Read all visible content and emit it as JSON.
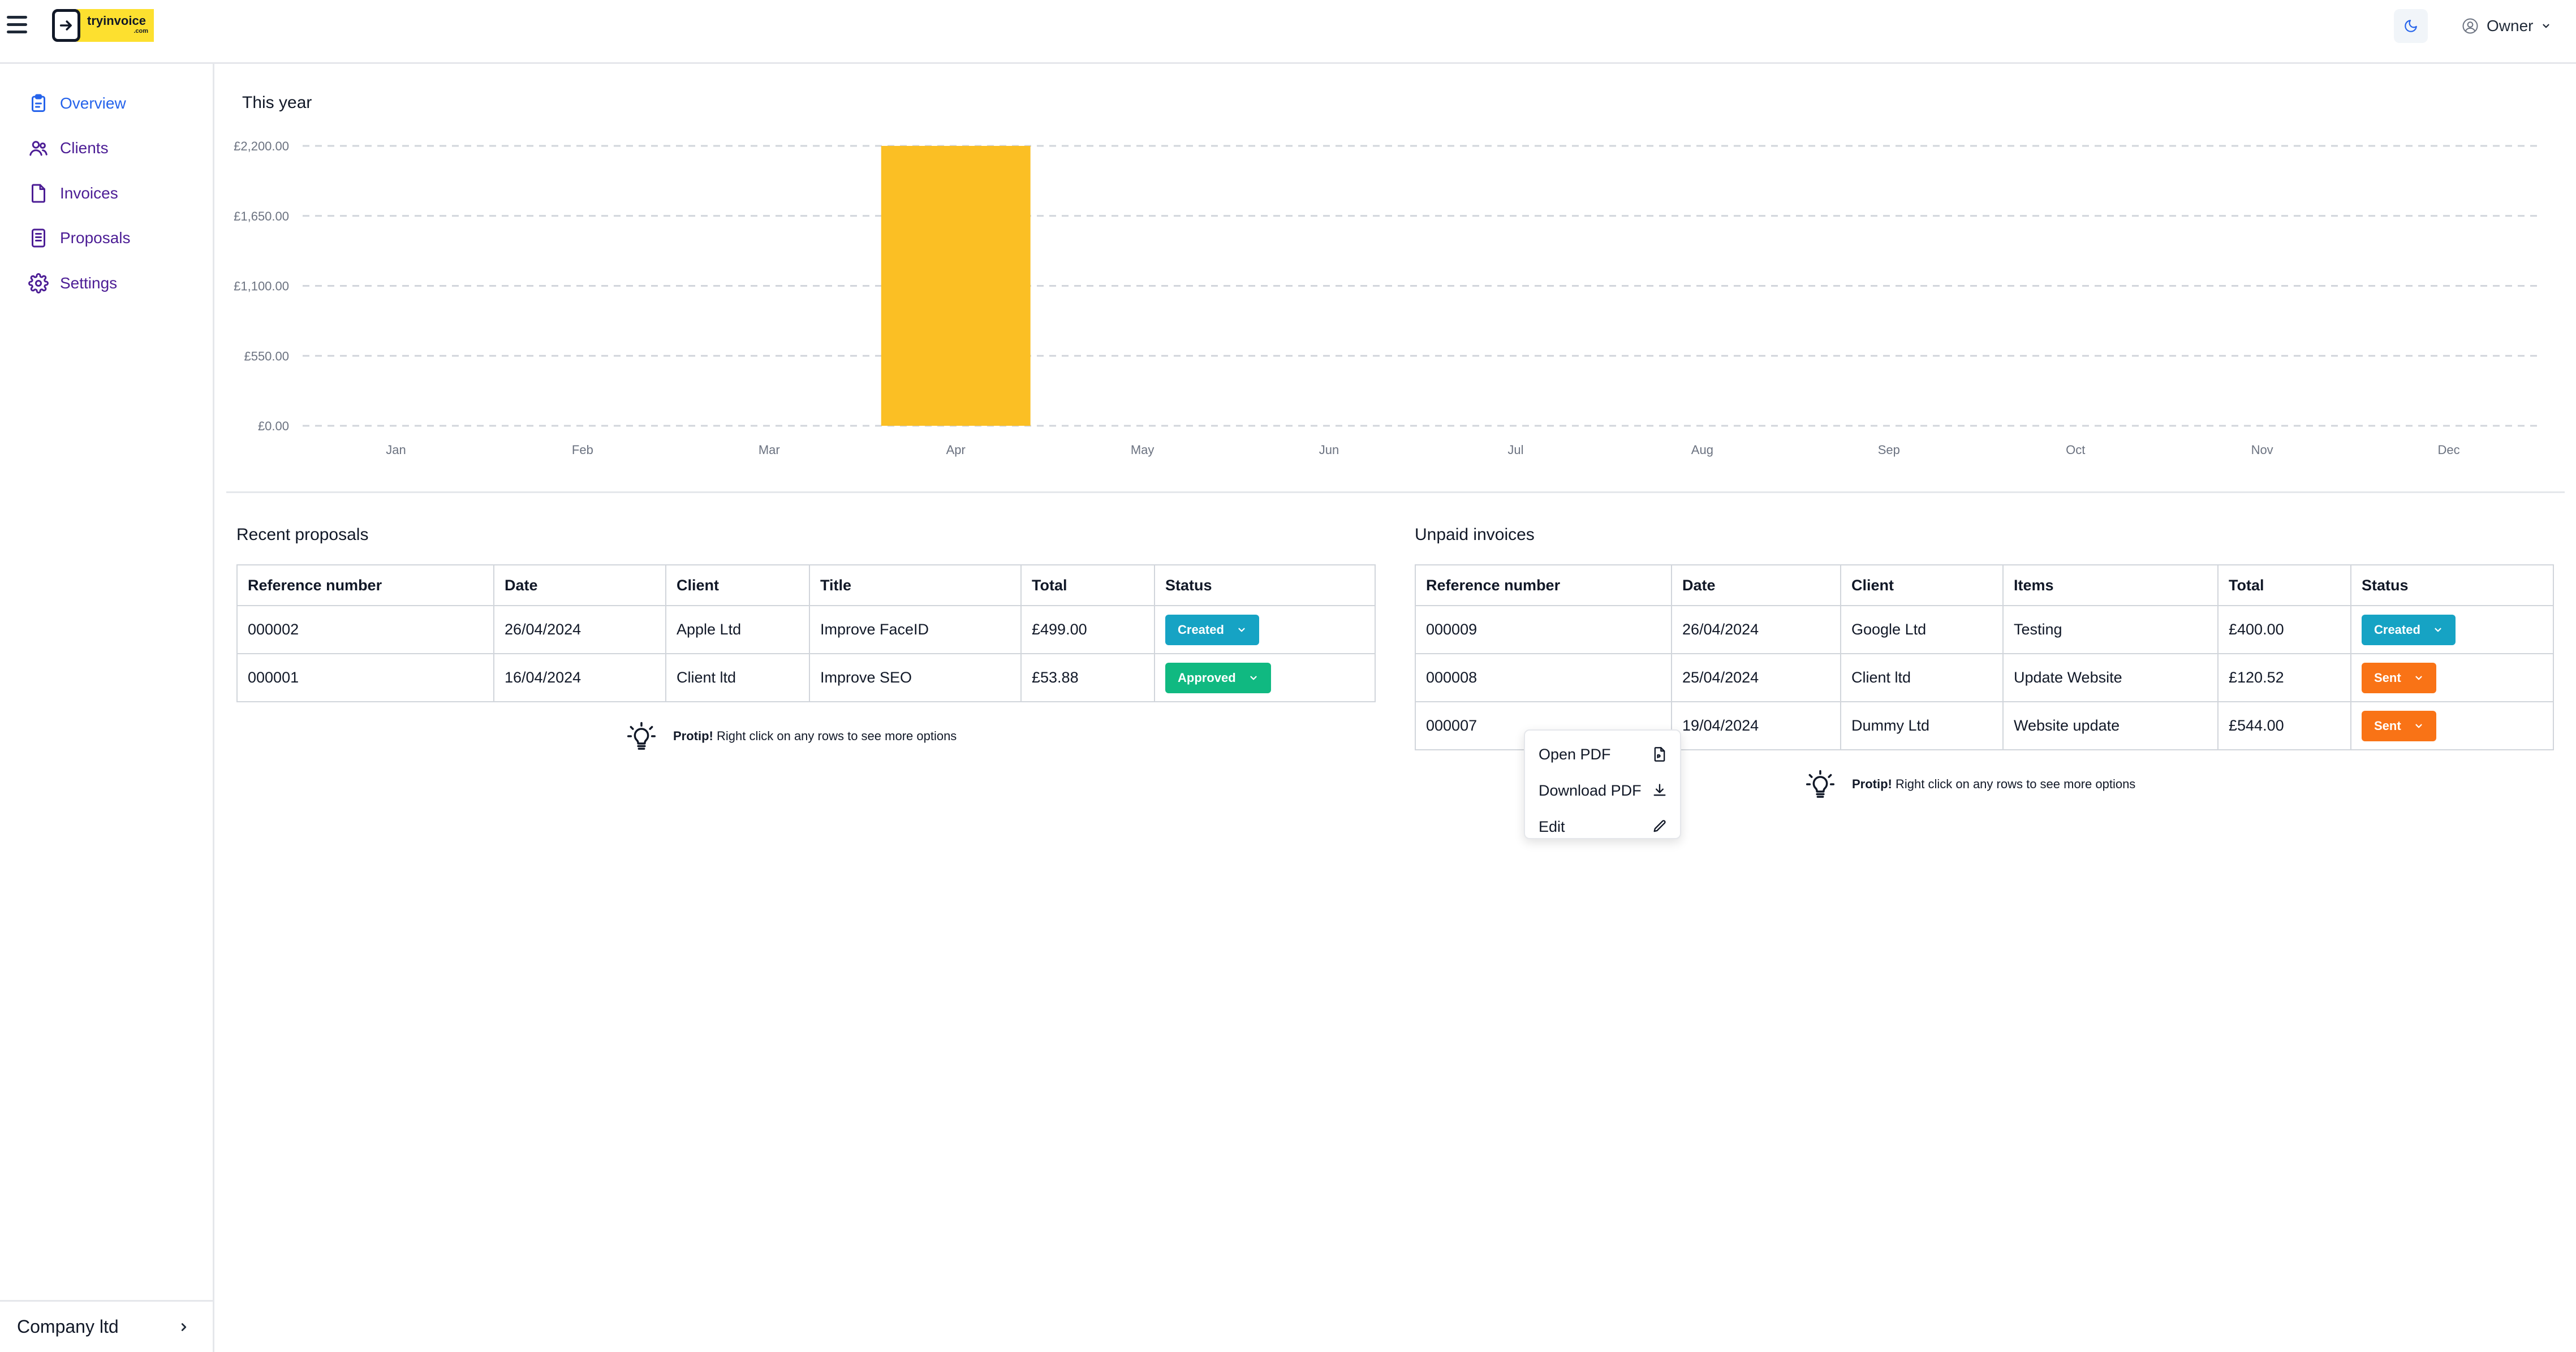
{
  "header": {
    "logo_text": "tryinvoice",
    "logo_suffix": ".com",
    "user_label": "Owner"
  },
  "sidebar": {
    "items": [
      {
        "label": "Overview",
        "icon": "clipboard-icon",
        "active": true
      },
      {
        "label": "Clients",
        "icon": "users-icon",
        "active": false
      },
      {
        "label": "Invoices",
        "icon": "file-icon",
        "active": false
      },
      {
        "label": "Proposals",
        "icon": "document-list-icon",
        "active": false
      },
      {
        "label": "Settings",
        "icon": "gear-icon",
        "active": false
      }
    ],
    "company": "Company ltd"
  },
  "chart": {
    "title": "This year"
  },
  "chart_data": {
    "type": "bar",
    "title": "This year",
    "categories": [
      "Jan",
      "Feb",
      "Mar",
      "Apr",
      "May",
      "Jun",
      "Jul",
      "Aug",
      "Sep",
      "Oct",
      "Nov",
      "Dec"
    ],
    "values": [
      0,
      0,
      0,
      2200,
      0,
      0,
      0,
      0,
      0,
      0,
      0,
      0
    ],
    "y_ticks": [
      "£0.00",
      "£550.00",
      "£1,100.00",
      "£1,650.00",
      "£2,200.00"
    ],
    "y_tick_values": [
      0,
      550,
      1100,
      1650,
      2200
    ],
    "ylim": [
      0,
      2200
    ],
    "bar_color": "#fbbf24",
    "grid": true
  },
  "proposals": {
    "title": "Recent proposals",
    "columns": [
      "Reference number",
      "Date",
      "Client",
      "Title",
      "Total",
      "Status"
    ],
    "rows": [
      {
        "ref": "000002",
        "date": "26/04/2024",
        "client": "Apple Ltd",
        "title": "Improve FaceID",
        "total": "£499.00",
        "status": "Created"
      },
      {
        "ref": "000001",
        "date": "16/04/2024",
        "client": "Client ltd",
        "title": "Improve SEO",
        "total": "£53.88",
        "status": "Approved"
      }
    ]
  },
  "invoices": {
    "title": "Unpaid invoices",
    "columns": [
      "Reference number",
      "Date",
      "Client",
      "Items",
      "Total",
      "Status"
    ],
    "rows": [
      {
        "ref": "000009",
        "date": "26/04/2024",
        "client": "Google Ltd",
        "items": "Testing",
        "total": "£400.00",
        "status": "Created"
      },
      {
        "ref": "000008",
        "date": "25/04/2024",
        "client": "Client ltd",
        "items": "Update Website",
        "total": "£120.52",
        "status": "Sent"
      },
      {
        "ref": "000007",
        "date": "19/04/2024",
        "client": "Dummy Ltd",
        "items": "Website update",
        "total": "£544.00",
        "status": "Sent"
      }
    ]
  },
  "protip": {
    "bold": "Protip!",
    "text": " Right click on any rows to see more options"
  },
  "context_menu": {
    "items": [
      {
        "label": "Open PDF",
        "icon": "file-pdf-icon"
      },
      {
        "label": "Download PDF",
        "icon": "download-icon"
      },
      {
        "label": "Edit",
        "icon": "pencil-icon"
      }
    ]
  },
  "colors": {
    "accent": "#2563eb",
    "nav_text": "#4c1d95",
    "created": "#16a3c4",
    "approved": "#10b981",
    "sent": "#f97316",
    "logo_bg": "#fde02f"
  }
}
